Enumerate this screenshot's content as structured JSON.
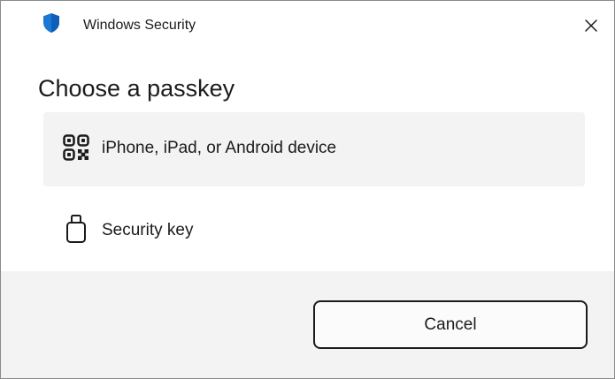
{
  "window": {
    "title": "Windows Security",
    "app_icon": "shield-icon",
    "close_icon": "close-icon"
  },
  "dialog": {
    "heading": "Choose a passkey",
    "options": [
      {
        "label": "iPhone, iPad, or Android device",
        "icon": "qr-code-icon",
        "selected": true
      },
      {
        "label": "Security key",
        "icon": "usb-key-icon",
        "selected": false
      }
    ]
  },
  "footer": {
    "cancel_label": "Cancel"
  },
  "colors": {
    "shield_blue": "#1a78d6",
    "selected_bg": "#f3f3f3",
    "footer_bg": "#f3f3f3",
    "text": "#1b1b1b"
  }
}
